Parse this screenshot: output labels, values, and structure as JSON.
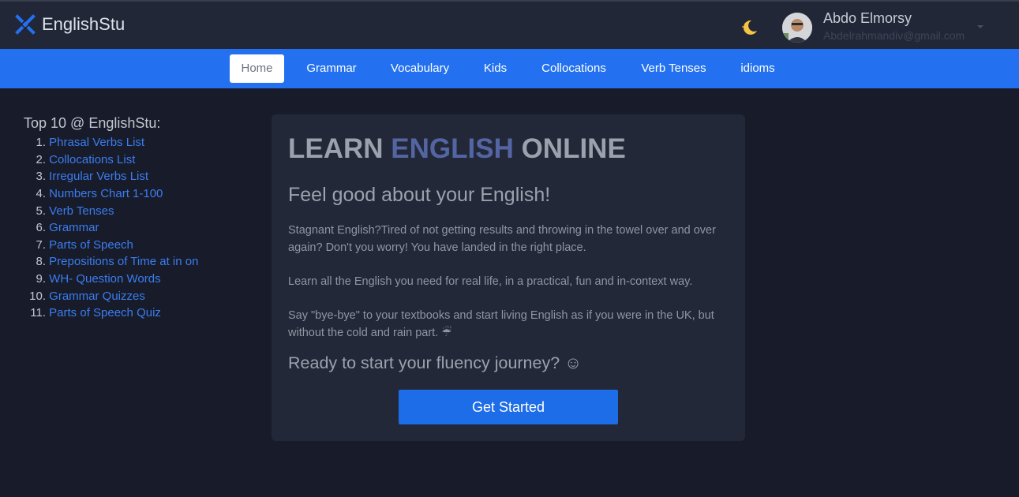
{
  "header": {
    "brand_name": "EnglishStu",
    "user_name": "Abdo Elmorsy",
    "user_email": "Abdelrahmandiv@gmail.com",
    "theme_icon": "moon-icon",
    "brand_icon": "logo-icon"
  },
  "nav": {
    "items": [
      {
        "label": "Home",
        "active": true
      },
      {
        "label": "Grammar"
      },
      {
        "label": "Vocabulary"
      },
      {
        "label": "Kids"
      },
      {
        "label": "Collocations"
      },
      {
        "label": "Verb Tenses"
      },
      {
        "label": "idioms"
      }
    ]
  },
  "sidebar": {
    "title": "Top 10 @ EnglishStu:",
    "items": [
      {
        "num": "1.",
        "label": "Phrasal Verbs List"
      },
      {
        "num": "2.",
        "label": "Collocations List"
      },
      {
        "num": "3.",
        "label": "Irregular Verbs List"
      },
      {
        "num": "4.",
        "label": "Numbers Chart 1-100"
      },
      {
        "num": "5.",
        "label": "Verb Tenses"
      },
      {
        "num": "6.",
        "label": "Grammar"
      },
      {
        "num": "7.",
        "label": "Parts of Speech"
      },
      {
        "num": "8.",
        "label": "Prepositions of Time at in on"
      },
      {
        "num": "9.",
        "label": "WH- Question Words"
      },
      {
        "num": "10.",
        "label": "Grammar Quizzes"
      },
      {
        "num": "11.",
        "label": "Parts of Speech Quiz"
      }
    ]
  },
  "hero": {
    "title_part1": "LEARN ",
    "title_accent": "ENGLISH",
    "title_part2": " ONLINE",
    "subtitle": "Feel good about your English!",
    "paragraph1": "Stagnant English?Tired of not getting results and throwing in the towel over and over again? Don't you worry! You have landed in the right place.",
    "paragraph2": "Learn all the English you need for real life, in a practical, fun and in-context way.",
    "paragraph3": "Say \"bye-bye\" to your textbooks and start living English as if you were in the UK, but without the cold and rain part. ☔",
    "cta_text": "Ready to start your fluency journey? ☺",
    "button_label": "Get Started"
  },
  "colors": {
    "nav_blue": "#2371f0",
    "header_bg": "#222738",
    "page_bg": "#181b29",
    "card_bg": "#232838",
    "link": "#3a7df0",
    "accent_title": "#5465a3",
    "button": "#1d6ce8"
  }
}
